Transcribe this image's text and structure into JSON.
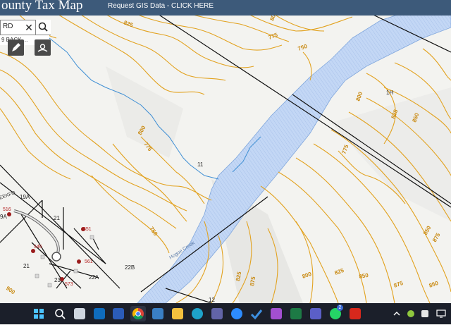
{
  "header": {
    "title": "ounty Tax Map",
    "gis_link": "Request GIS Data - CLICK HERE"
  },
  "search": {
    "value": "RD",
    "suggestion": "9 BACK ..."
  },
  "map": {
    "creek_label": "Hogue Creek",
    "parcels": [
      "1H",
      "11",
      "19A",
      "21",
      "21",
      "22B",
      "22A",
      "23",
      "12",
      "9A"
    ],
    "addresses": [
      "516",
      "551",
      "546",
      "561",
      "573"
    ],
    "road_fragment": "EEKFO",
    "contours": [
      "800",
      "775",
      "750",
      "825",
      "800",
      "775",
      "750",
      "800",
      "825",
      "850",
      "775",
      "850",
      "875",
      "825",
      "875",
      "800",
      "825",
      "850",
      "875",
      "850",
      "900"
    ]
  },
  "taskbar": {
    "whatsapp_badge": "2"
  },
  "colors": {
    "header_bg": "#3d5a7a",
    "water": "#b9d2f3",
    "stream": "#3f8fd4",
    "contour": "#e2a21f",
    "taskbar_bg": "#1b1f2a"
  }
}
